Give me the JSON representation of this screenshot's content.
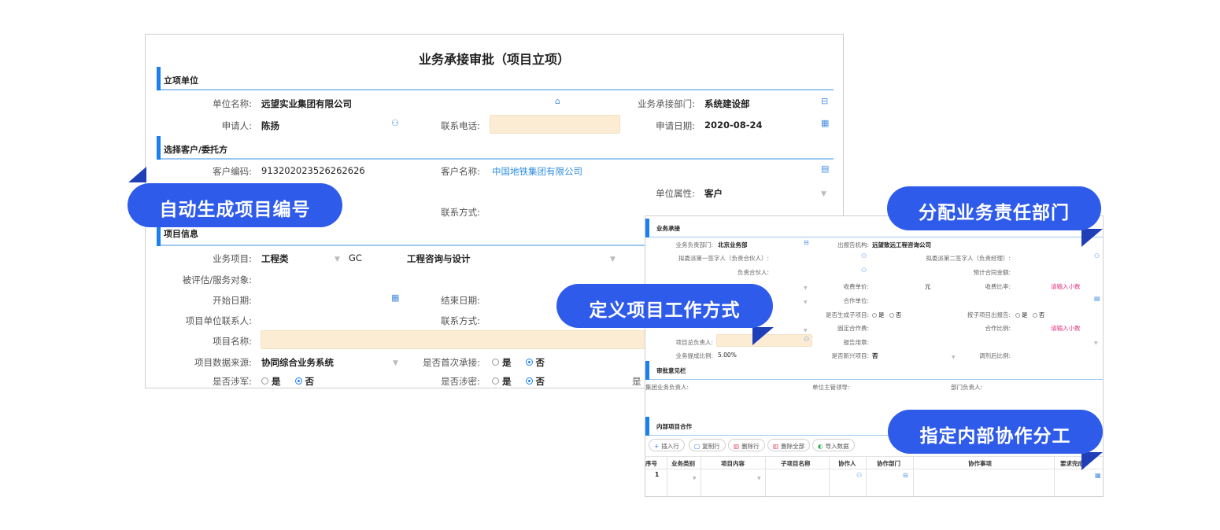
{
  "colors": {
    "accent": "#1a7ff0",
    "callout": "#2f5bea",
    "highlight_field": "#fdecd4",
    "link": "#2f8dde",
    "hint": "#e0307e"
  },
  "form": {
    "title": "业务承接审批（项目立项）",
    "section_unit": "立项单位",
    "unit_name_label": "单位名称:",
    "unit_name_value": "远望实业集团有限公司",
    "dept_label": "业务承接部门:",
    "dept_value": "系统建设部",
    "applicant_label": "申请人:",
    "applicant_value": "陈扬",
    "phone_label": "联系电话:",
    "phone_value": "",
    "apply_date_label": "申请日期:",
    "apply_date_value": "2020-08-24",
    "section_customer": "选择客户/委托方",
    "customer_code_label": "客户编码:",
    "customer_code_value": "913202023526262626",
    "customer_name_label": "客户名称:",
    "customer_name_value": "中国地铁集团有限公司",
    "unit_attr_label": "单位属性:",
    "unit_attr_value": "客户",
    "contact_label": "联系方式:",
    "contact_value": "",
    "section_project": "项目信息",
    "biz_item_label": "业务项目:",
    "biz_item_value": "工程类",
    "biz_item_code": "GC",
    "biz_item_sub": "工程咨询与设计",
    "object_label": "被评估/服务对象:",
    "start_label": "开始日期:",
    "end_label": "结束日期:",
    "proj_contact_label": "项目单位联系人:",
    "contact2_label": "联系方式:",
    "proj_name_label": "项目名称:",
    "data_source_label": "项目数据来源:",
    "data_source_value": "协同综合业务系统",
    "first_label": "是否首次承接:",
    "military_label": "是否涉军:",
    "secret_label": "是否涉密:",
    "opt_yes": "是",
    "opt_no": "否",
    "cutoff_label": "是"
  },
  "panel": {
    "section_biz": "业务承接",
    "biz_dept_label": "业务负责部门:",
    "biz_dept_value": "北京业务部",
    "report_org_label": "出报告机构:",
    "report_org_value": "远望致远工程咨询公司",
    "signer1_label": "拟委派第一签字人（负责合伙人）:",
    "signer2_label": "拟委派第二签字人（负责经理）:",
    "partner_label": "负责合伙人:",
    "est_amount_label": "预计合同金额:",
    "fee_price_label": "收费单价:",
    "fee_unit": "元",
    "fee_ratio_label": "收费比率:",
    "decimal_hint": "请输入小数",
    "coop_unit_label": "合作单位:",
    "sub_proj_label": "是否生成子项目:",
    "sub_report_label": "按子项目出报告:",
    "fixed_fee_label": "固定合作费:",
    "coop_ratio_label": "合作比例:",
    "decimal_hint2": "请输入小数",
    "lead_label": "项目总负责人:",
    "seal_label": "报告用章:",
    "commission_label": "业务提成比例:",
    "commission_value": "5.00%",
    "new_proj_label": "是否新兴项目:",
    "new_proj_value": "否",
    "adjusted_label": "调剂后比例:",
    "yes": "是",
    "no": "否",
    "section_review": "审批意见栏",
    "group_head_label": "集团业务负责人:",
    "unit_leader_label": "单位主管领导:",
    "dept_head_label": "部门负责人:",
    "section_internal": "内部项目合作",
    "toolbar": [
      "插入行",
      "复制行",
      "删除行",
      "删除全部",
      "导入数据"
    ],
    "columns": [
      "序号",
      "业务类别",
      "项目内容",
      "子项目名称",
      "协作人",
      "协作部门",
      "协作事项",
      "要求完成"
    ],
    "row_index": "1"
  },
  "callouts": {
    "auto_number": "自动生成项目编号",
    "assign_dept": "分配业务责任部门",
    "define_mode": "定义项目工作方式",
    "assign_internal": "指定内部协作分工"
  },
  "icons": [
    "bank-icon",
    "org-icon",
    "user-icon",
    "calendar-icon",
    "calculator-icon",
    "chevron-down-icon",
    "plus-icon",
    "copy-icon",
    "delete-icon",
    "import-icon"
  ]
}
